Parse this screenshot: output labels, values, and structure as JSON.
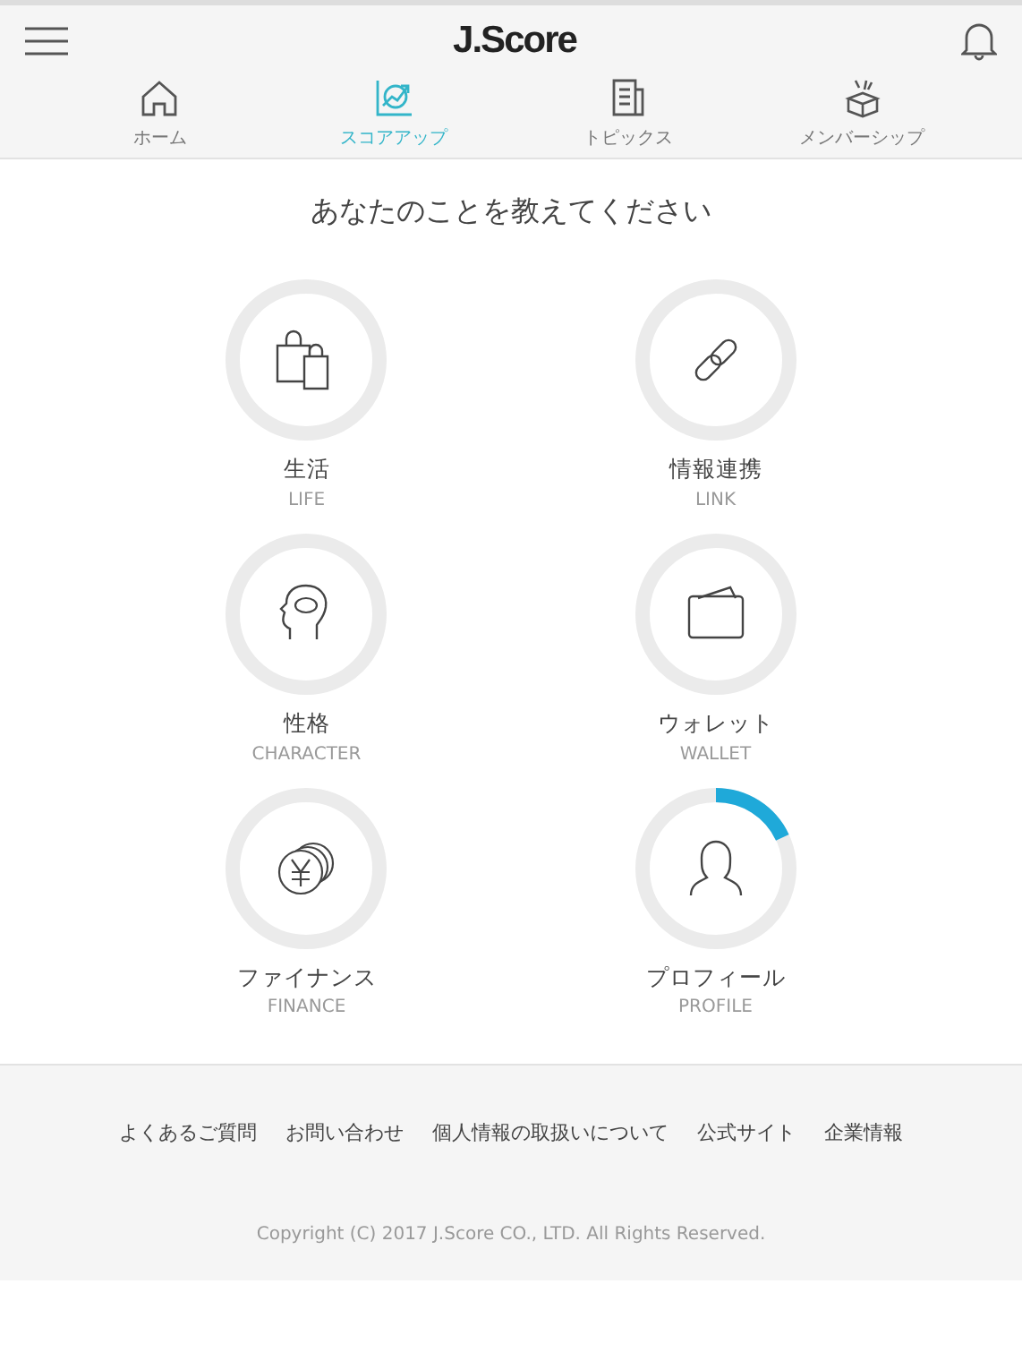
{
  "header": {
    "title": "J.Score"
  },
  "tabs": [
    {
      "label": "ホーム",
      "kind": "home",
      "selected": false
    },
    {
      "label": "スコアアップ",
      "kind": "scoreup",
      "selected": true
    },
    {
      "label": "トピックス",
      "kind": "topics",
      "selected": false
    },
    {
      "label": "メンバーシップ",
      "kind": "membership",
      "selected": false
    }
  ],
  "heading": "あなたのことを教えてください",
  "categories": [
    {
      "title": "生活",
      "subtitle": "LIFE",
      "kind": "bags",
      "started": false
    },
    {
      "title": "情報連携",
      "subtitle": "LINK",
      "kind": "link",
      "started": false
    },
    {
      "title": "性格",
      "subtitle": "CHARACTER",
      "kind": "head",
      "started": false
    },
    {
      "title": "ウォレット",
      "subtitle": "WALLET",
      "kind": "wallet",
      "started": false
    },
    {
      "title": "ファイナンス",
      "subtitle": "FINANCE",
      "kind": "coins",
      "started": false
    },
    {
      "title": "プロフィール",
      "subtitle": "PROFILE",
      "kind": "person",
      "started": true
    }
  ],
  "footer_links": [
    "よくあるご質問",
    "お問い合わせ",
    "個人情報の取扱いについて",
    "公式サイト",
    "企業情報"
  ],
  "copyright": "Copyright (C) 2017 J.Score CO., LTD. All Rights Reserved."
}
